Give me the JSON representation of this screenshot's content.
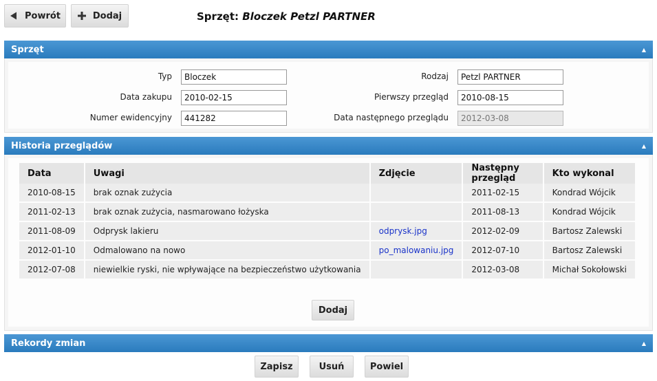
{
  "toolbar": {
    "back_label": "Powrót",
    "add_label": "Dodaj"
  },
  "page_title": {
    "prefix": "Sprzęt:",
    "name": "Bloczek Petzl PARTNER"
  },
  "equipment_section": {
    "title": "Sprzęt",
    "fields": {
      "typ_label": "Typ",
      "typ_value": "Bloczek",
      "data_zakupu_label": "Data zakupu",
      "data_zakupu_value": "2010-02-15",
      "numer_label": "Numer ewidencyjny",
      "numer_value": "441282",
      "rodzaj_label": "Rodzaj",
      "rodzaj_value": "Petzl PARTNER",
      "pierwszy_label": "Pierwszy przegląd",
      "pierwszy_value": "2010-08-15",
      "nastepny_label": "Data następnego przeglądu",
      "nastepny_value": "2012-03-08"
    }
  },
  "history_section": {
    "title": "Historia przeglądów",
    "columns": [
      "Data",
      "Uwagi",
      "Zdjęcie",
      "Następny przegląd",
      "Kto wykonal"
    ],
    "rows": [
      {
        "data": "2010-08-15",
        "uwagi": "brak oznak zużycia",
        "zdjecie": "",
        "nastepny": "2011-02-15",
        "kto": "Kondrad Wójcik"
      },
      {
        "data": "2011-02-13",
        "uwagi": "brak oznak zużycia, nasmarowano łożyska",
        "zdjecie": "",
        "nastepny": "2011-08-13",
        "kto": "Kondrad Wójcik"
      },
      {
        "data": "2011-08-09",
        "uwagi": "Odprysk lakieru",
        "zdjecie": "odprysk.jpg",
        "nastepny": "2012-02-09",
        "kto": "Bartosz Zalewski"
      },
      {
        "data": "2012-01-10",
        "uwagi": "Odmalowano na nowo",
        "zdjecie": "po_malowaniu.jpg",
        "nastepny": "2012-07-10",
        "kto": "Bartosz Zalewski"
      },
      {
        "data": "2012-07-08",
        "uwagi": "niewielkie ryski, nie wpływające na bezpieczeństwo użytkowania",
        "zdjecie": "",
        "nastepny": "2012-03-08",
        "kto": "Michał Sokołowski"
      }
    ],
    "add_label": "Dodaj"
  },
  "changes_section": {
    "title": "Rekordy zmian"
  },
  "footer": {
    "save_label": "Zapisz",
    "delete_label": "Usuń",
    "duplicate_label": "Powiel"
  },
  "icons": {
    "back": "arrow-left-icon",
    "add": "plus-icon",
    "collapse": "caret-up-icon"
  },
  "colors": {
    "header_blue": "#2a7bbd",
    "link": "#1a33c9"
  }
}
